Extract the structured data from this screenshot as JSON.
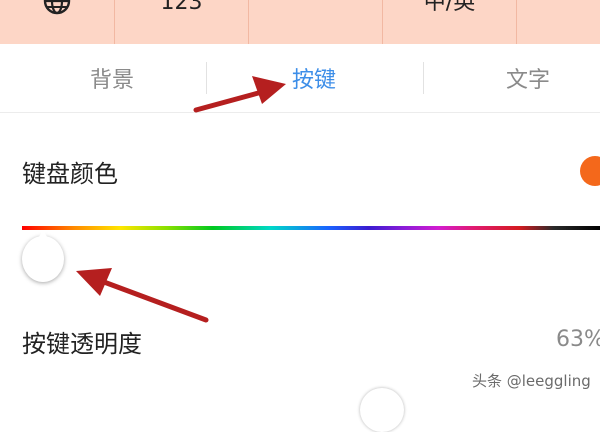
{
  "keyboard_keys": {
    "globe_icon": "globe-icon",
    "key2_label": "123",
    "key4_label": "中/英"
  },
  "tabs": [
    {
      "label": "背景",
      "active": false
    },
    {
      "label": "按键",
      "active": true
    },
    {
      "label": "文字",
      "active": false
    }
  ],
  "settings": {
    "color_label": "键盘颜色",
    "color_swatch": "#f4681b",
    "color_slider_position": 0.0,
    "transparency_label": "按键透明度",
    "transparency_value": "63%"
  },
  "watermark": "头条 @leeggling",
  "colors": {
    "accent": "#3d8ee8",
    "annotation_arrow": "#b51f1f",
    "key_background": "#fdd6c6"
  }
}
